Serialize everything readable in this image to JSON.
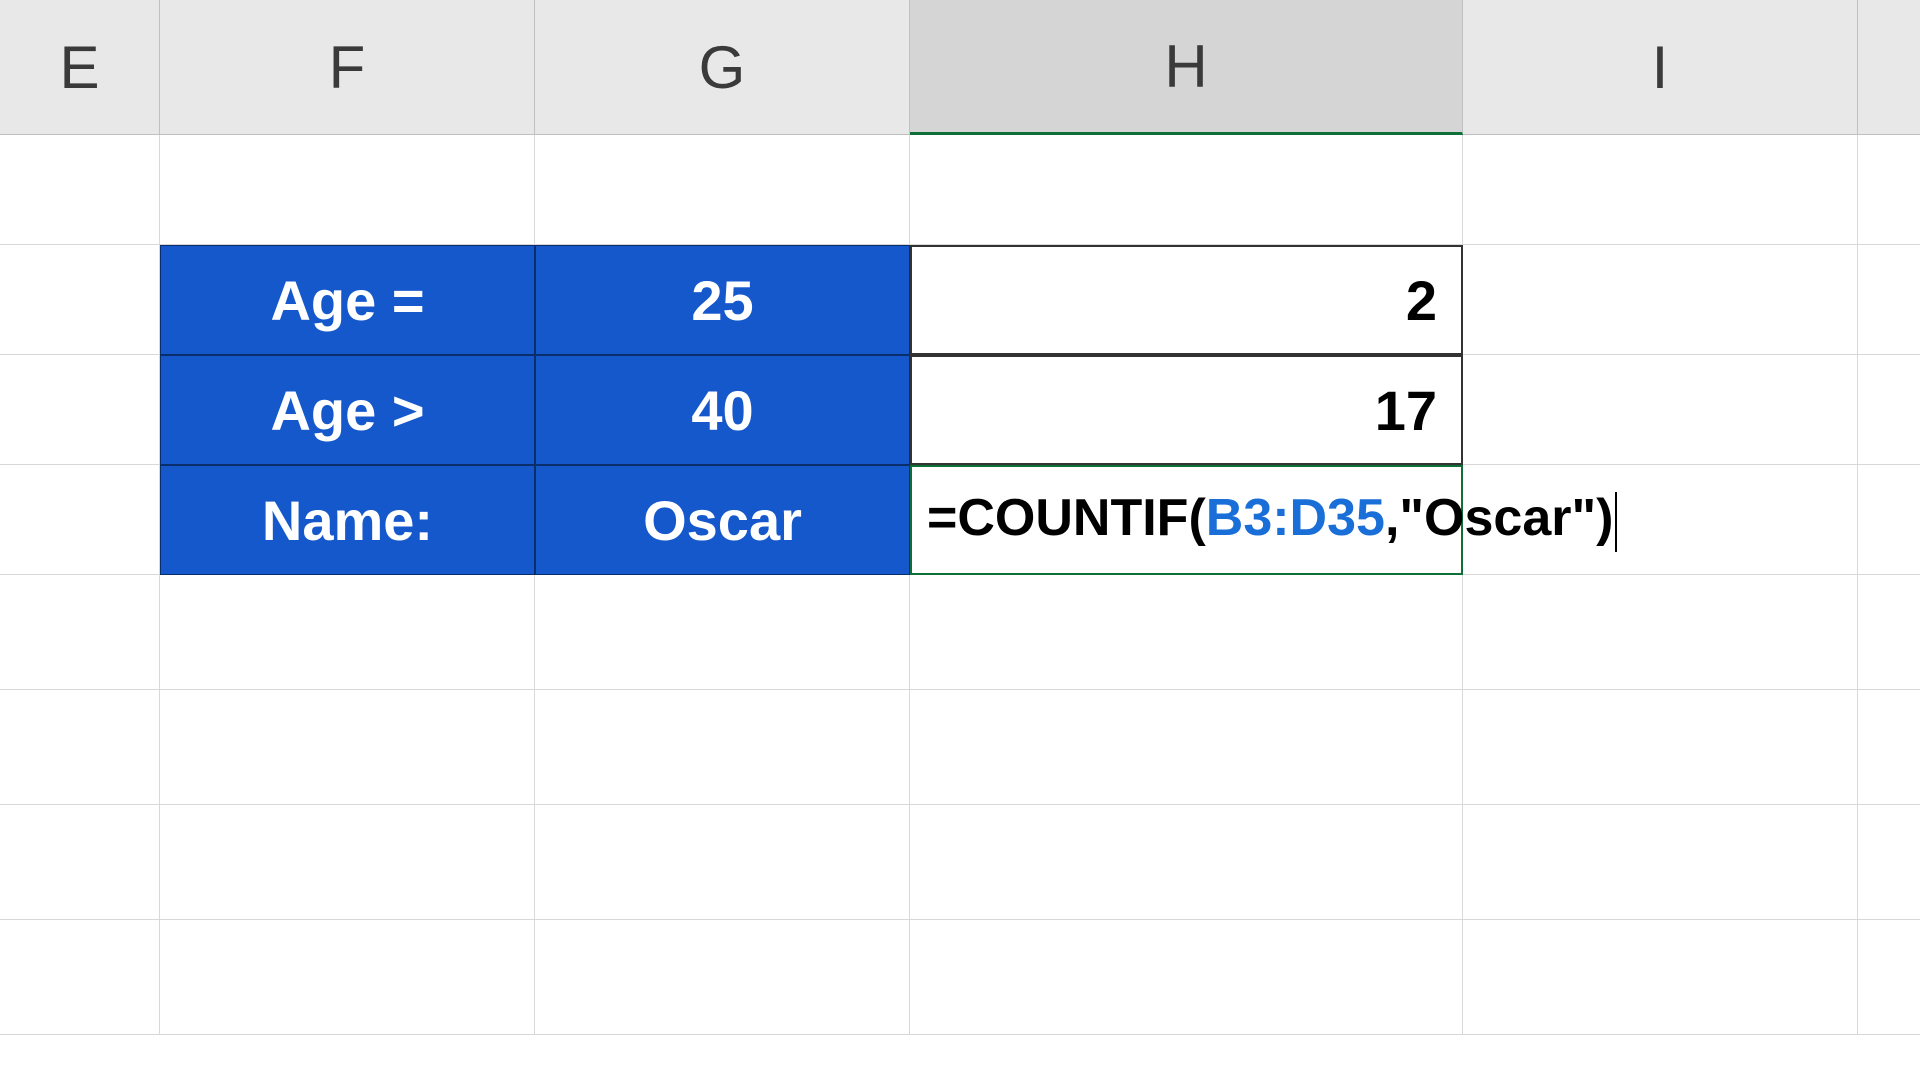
{
  "columns": {
    "E": "E",
    "F": "F",
    "G": "G",
    "H": "H",
    "I": "I"
  },
  "rows": {
    "r2": {
      "F": "Age =",
      "G": "25",
      "H": "2"
    },
    "r3": {
      "F": "Age >",
      "G": "40",
      "H": "17"
    },
    "r4": {
      "F": "Name:",
      "G": "Oscar",
      "H_formula": {
        "prefix": "=COUNTIF(",
        "ref": "B3:D35",
        "suffix": ",\"Oscar\")"
      }
    }
  },
  "colors": {
    "blue_bg": "#1558cc",
    "selection_border": "#0e7038",
    "ref_color": "#1a6ed8"
  }
}
